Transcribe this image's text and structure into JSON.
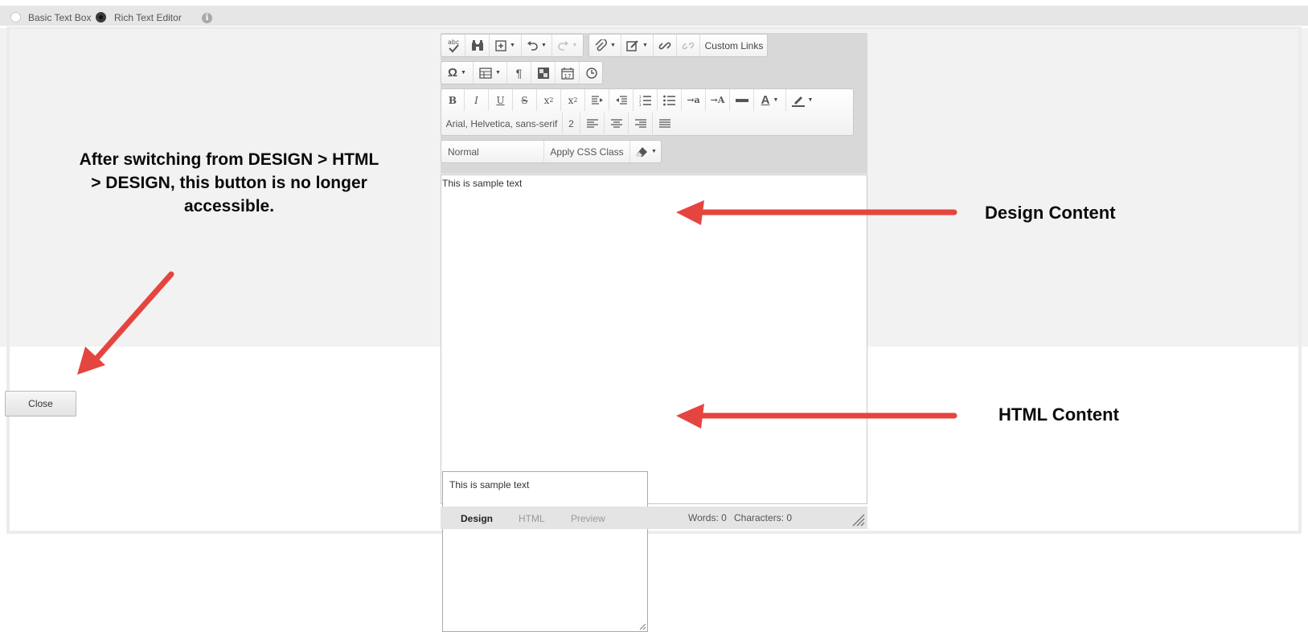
{
  "mode_bar": {
    "options": [
      {
        "label": "Basic Text Box",
        "selected": false
      },
      {
        "label": "Rich Text Editor",
        "selected": true
      }
    ],
    "info_icon": "info-icon"
  },
  "toolbar": {
    "row1": {
      "spellcheck_icon": "spellcheck-icon",
      "find_icon": "binoculars-icon",
      "insert_icon": "insert-plus-icon",
      "undo_icon": "undo-icon",
      "redo_icon": "redo-icon",
      "attach_icon": "paperclip-icon",
      "edit_icon": "edit-icon",
      "link_icon": "link-icon",
      "unlink_icon": "unlink-icon",
      "custom_links_label": "Custom Links"
    },
    "row2": {
      "symbol_icon": "omega-icon",
      "table_icon": "table-icon",
      "paragraph_icon": "pilcrow-icon",
      "image_icon": "image-icon",
      "date_icon": "calendar-icon",
      "time_icon": "clock-icon",
      "calendar_day": "17"
    },
    "row3": {
      "bold_label": "B",
      "italic_label": "I",
      "underline_label": "U",
      "strike_label": "S",
      "superscript_label": "x",
      "superscript_exp": "2",
      "subscript_label": "x",
      "subscript_exp": "2",
      "ltr_label": "→a",
      "rtl_label": "→A",
      "font_color_label": "A",
      "font_family": "Arial, Helvetica, sans-serif",
      "font_size": "2"
    },
    "row4": {
      "block_format": "Normal",
      "apply_css_label": "Apply CSS Class",
      "clear_format_icon": "eraser-icon"
    }
  },
  "design_content": {
    "text": "This is sample text"
  },
  "html_content": {
    "text": "This is sample text"
  },
  "status_bar": {
    "tabs": [
      {
        "label": "Design",
        "active": true
      },
      {
        "label": "HTML",
        "active": false
      },
      {
        "label": "Preview",
        "active": false
      }
    ],
    "words": "Words: 0",
    "characters": "Characters: 0"
  },
  "close_button": {
    "label": "Close"
  },
  "annotations": {
    "note": "After switching from DESIGN > HTML > DESIGN, this button is no longer accessible.",
    "design_label": "Design Content",
    "html_label": "HTML Content",
    "arrow_color": "#e5453f"
  }
}
